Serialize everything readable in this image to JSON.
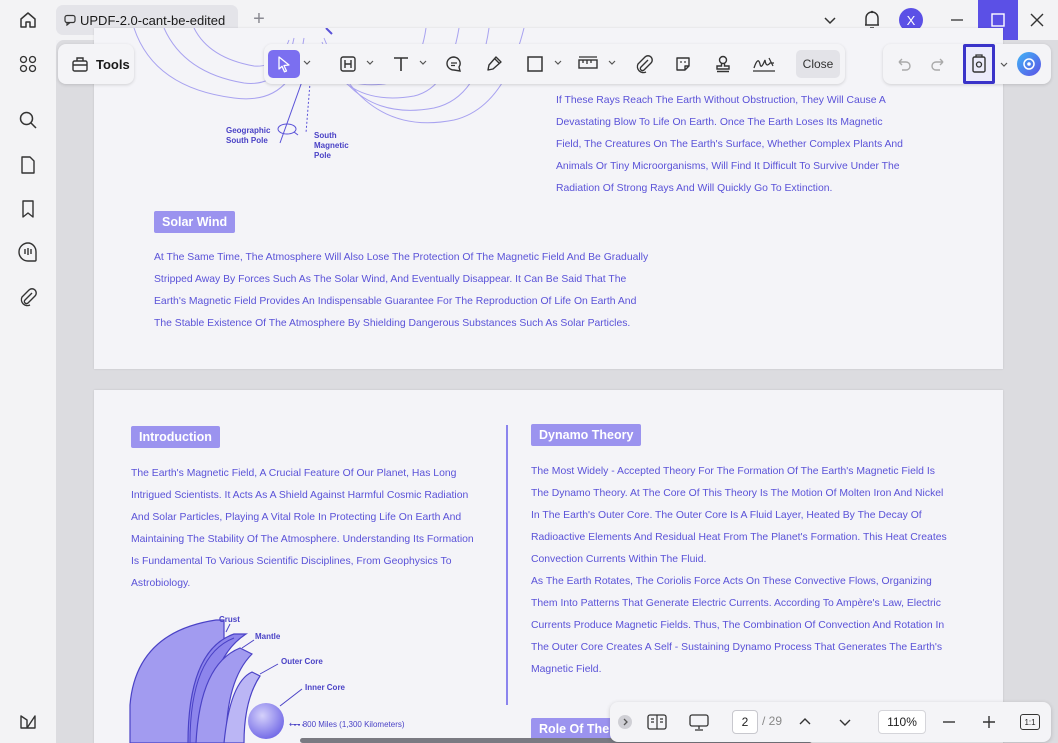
{
  "window": {
    "tab_title": "UPDF-2.0-cant-be-edited",
    "avatar_letter": "X",
    "accent": "#5b50e6"
  },
  "toolbar": {
    "tools_label": "Tools",
    "close_label": "Close",
    "items": [
      "select-icon",
      "highlight-icon",
      "text-icon",
      "comment-icon",
      "pencil-icon",
      "rectangle-icon",
      "measure-icon",
      "attachment-icon",
      "sticker-icon",
      "stamp-icon",
      "signature-icon"
    ]
  },
  "sidebar": {
    "items": [
      "thumbnails-icon",
      "search-icon",
      "pages-icon",
      "bookmark-icon",
      "comments-icon",
      "attachments-icon",
      "layers-icon"
    ]
  },
  "page1": {
    "fig_labels": {
      "geo_south": "Geographic\nSouth Pole",
      "mag_south": "South\nMagnetic\nPole"
    },
    "rays_lines": [
      "If These Rays Reach The Earth Without Obstruction, They Will Cause A",
      "Devastating Blow To Life On Earth. Once The Earth Loses Its Magnetic",
      "Field, The Creatures On The Earth's Surface, Whether Complex Plants And",
      "Animals Or Tiny Microorganisms, Will Find It Difficult To Survive Under The",
      "Radiation Of Strong Rays And Will Quickly Go To Extinction."
    ],
    "solar_wind_heading": "Solar Wind",
    "solar_wind_lines": [
      "At The Same Time, The Atmosphere Will Also Lose The Protection Of The Magnetic Field And Be Gradually",
      "Stripped Away By Forces Such As The Solar Wind, And Eventually Disappear. It Can Be Said That The",
      "Earth's Magnetic Field Provides An Indispensable Guarantee For The Reproduction Of Life On Earth And",
      "The Stable Existence Of The Atmosphere By Shielding Dangerous Substances Such As Solar Particles."
    ]
  },
  "page2": {
    "intro_heading": "Introduction",
    "intro_lines": [
      "The Earth's Magnetic Field, A Crucial Feature Of Our Planet, Has Long",
      "Intrigued Scientists. It Acts As A Shield Against Harmful Cosmic Radiation",
      "And Solar Particles, Playing A Vital Role In Protecting Life On Earth And",
      "Maintaining The Stability Of The Atmosphere. Understanding Its Formation",
      "Is Fundamental To Various Scientific Disciplines, From Geophysics To",
      "Astrobiology."
    ],
    "layers": {
      "crust": "Crust",
      "mantle": "Mantle",
      "outer_core": "Outer Core",
      "inner_core": "Inner Core",
      "distance": "800 Miles (1,300 Kilometers)"
    },
    "dynamo_heading": "Dynamo Theory",
    "dynamo_lines": [
      "The Most Widely - Accepted Theory For The Formation Of The Earth's Magnetic Field Is",
      "The Dynamo Theory. At The Core Of This Theory Is The Motion Of Molten Iron And Nickel",
      "In The Earth's Outer Core. The Outer Core Is A Fluid Layer, Heated By The Decay Of",
      "Radioactive Elements And Residual Heat From The Planet's Formation. This Heat Creates",
      "Convection Currents Within The Fluid.",
      "As The Earth Rotates, The Coriolis Force Acts On These Convective Flows, Organizing",
      "Them Into Patterns That Generate Electric Currents. According To Ampère's Law, Electric",
      "Currents Produce Magnetic Fields. Thus, The Combination Of Convection And Rotation In",
      "The Outer Core Creates A Self - Sustaining Dynamo Process That Generates The Earth's",
      "Magnetic Field."
    ],
    "role_heading": "Role Of The"
  },
  "nav": {
    "current_page": "2",
    "total_pages": "/ 29",
    "zoom": "110%",
    "fit_label": "1:1"
  }
}
